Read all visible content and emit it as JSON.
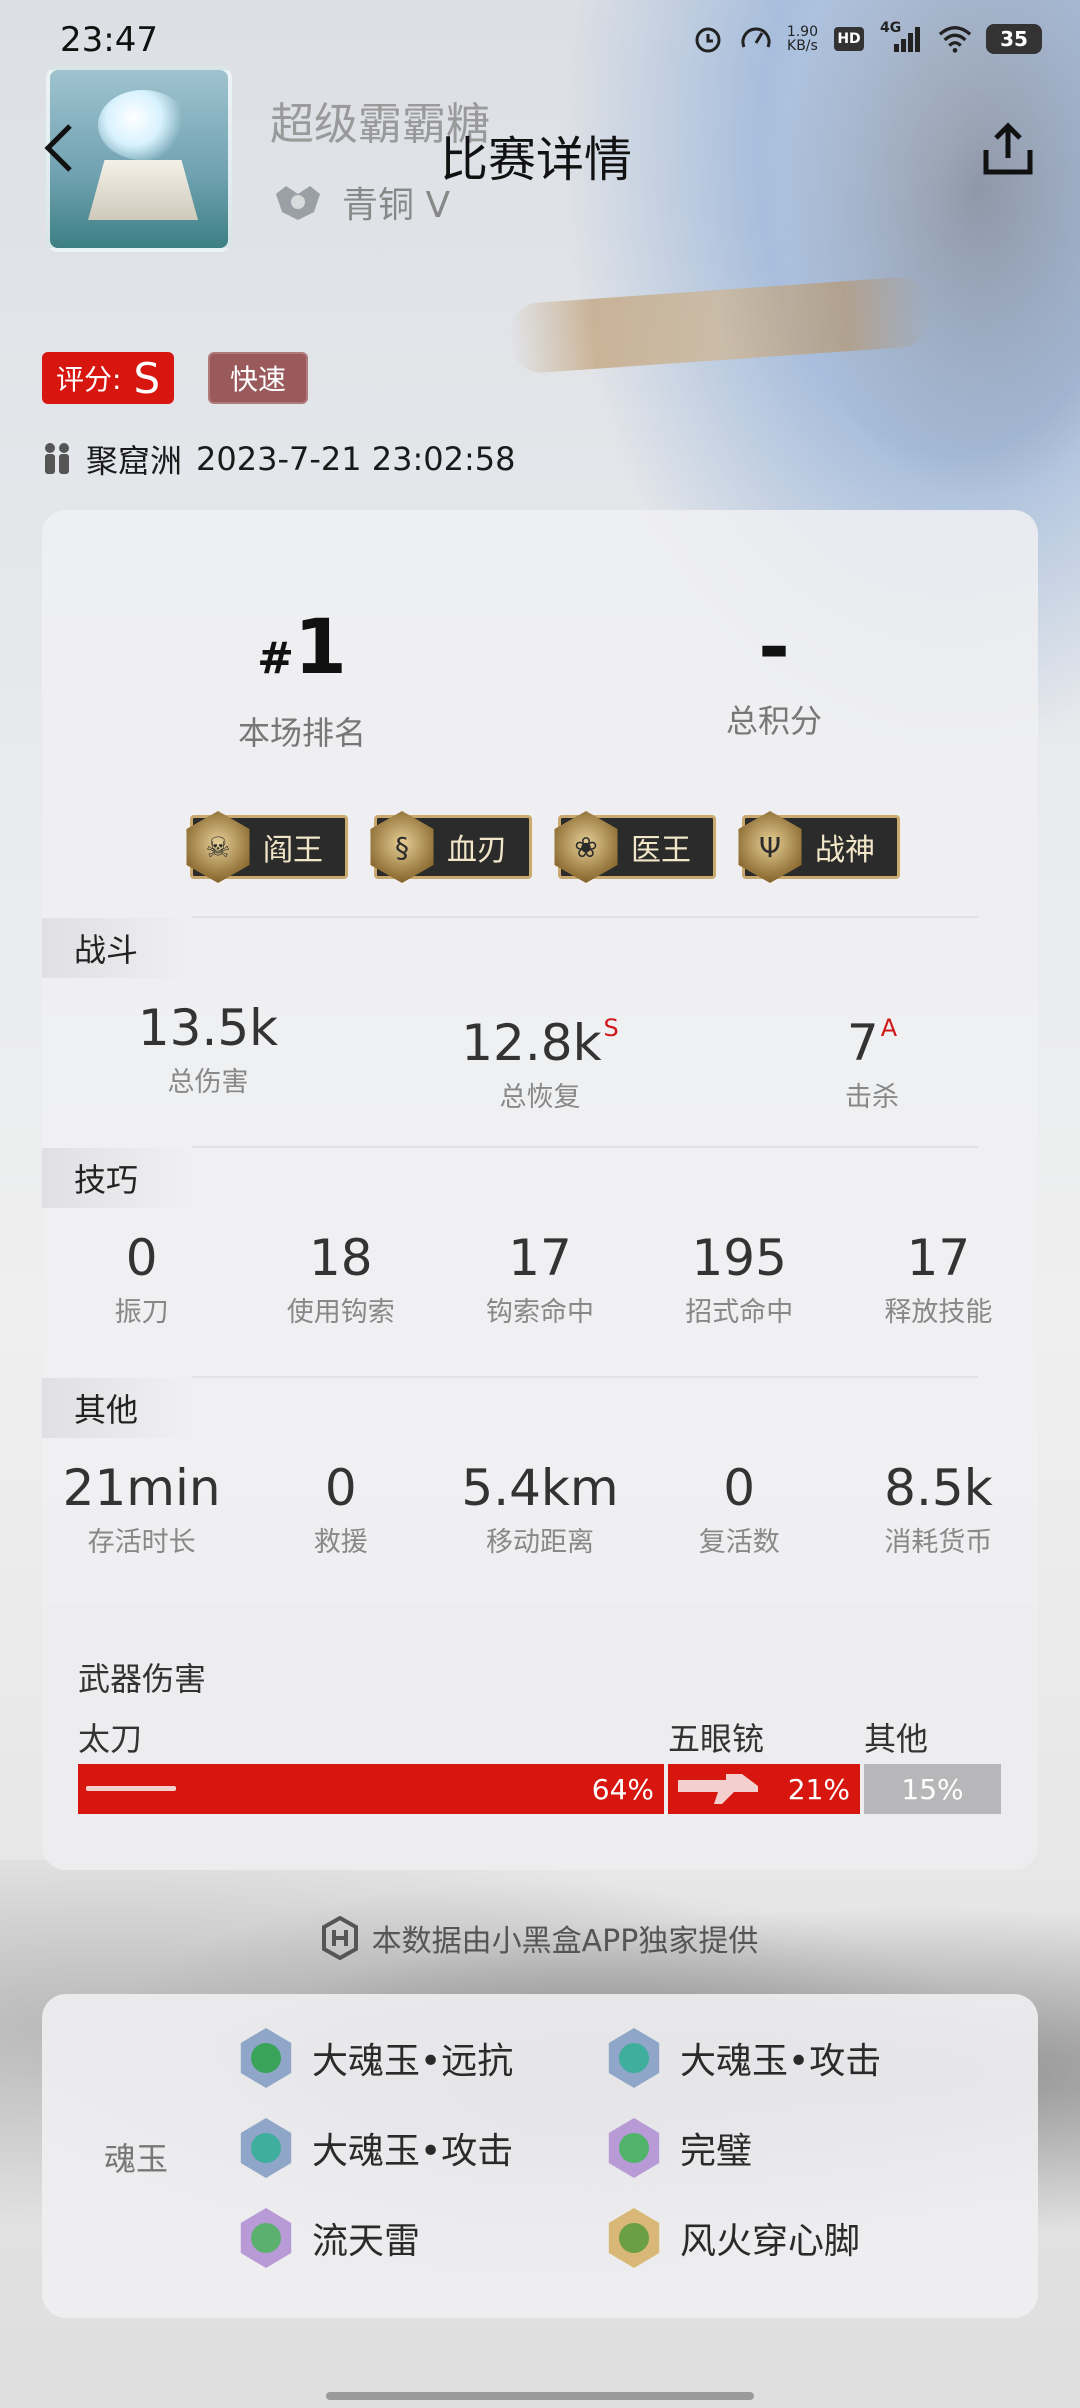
{
  "status_bar": {
    "time": "23:47",
    "speed_value": "1.90",
    "speed_unit": "KB/s",
    "hd": "HD",
    "network": "4G",
    "battery": "35"
  },
  "header": {
    "title": "比赛详情",
    "username": "超级霸霸糖",
    "rank": "青铜 V"
  },
  "match": {
    "score_label": "评分:",
    "score_grade": "S",
    "mode": "快速",
    "map": "聚窟洲",
    "datetime": "2023-7-21 23:02:58"
  },
  "summary": {
    "rank_hash": "#",
    "rank_value": "1",
    "rank_label": "本场排名",
    "points_value": "-",
    "points_label": "总积分"
  },
  "honors": [
    {
      "icon": "demon-mask-icon",
      "label": "阎王"
    },
    {
      "icon": "dragon-blade-icon",
      "label": "血刃"
    },
    {
      "icon": "lotus-icon",
      "label": "医王"
    },
    {
      "icon": "trident-icon",
      "label": "战神"
    }
  ],
  "combat": {
    "title": "战斗",
    "stats": [
      {
        "value": "13.5k",
        "tag": "",
        "label": "总伤害"
      },
      {
        "value": "12.8k",
        "tag": "S",
        "label": "总恢复"
      },
      {
        "value": "7",
        "tag": "A",
        "label": "击杀"
      }
    ]
  },
  "skill": {
    "title": "技巧",
    "stats": [
      {
        "value": "0",
        "label": "振刀"
      },
      {
        "value": "18",
        "label": "使用钩索"
      },
      {
        "value": "17",
        "label": "钩索命中"
      },
      {
        "value": "195",
        "label": "招式命中"
      },
      {
        "value": "17",
        "label": "释放技能"
      }
    ]
  },
  "other": {
    "title": "其他",
    "stats": [
      {
        "value": "21min",
        "label": "存活时长"
      },
      {
        "value": "0",
        "label": "救援"
      },
      {
        "value": "5.4km",
        "label": "移动距离"
      },
      {
        "value": "0",
        "label": "复活数"
      },
      {
        "value": "8.5k",
        "label": "消耗货币"
      }
    ]
  },
  "weapons": {
    "title": "武器伤害",
    "items": [
      {
        "name": "太刀",
        "percent": "64%",
        "share": 0.64,
        "color": "#d7160f"
      },
      {
        "name": "五眼铳",
        "percent": "21%",
        "share": 0.21,
        "color": "#d7160f"
      },
      {
        "name": "其他",
        "percent": "15%",
        "share": 0.15,
        "color": "#b7b7b9"
      }
    ]
  },
  "provider": "本数据由小黑盒APP独家提供",
  "soul_jade": {
    "label": "魂玉",
    "items": [
      {
        "name": "大魂玉•远抗",
        "color": "#3aa35a"
      },
      {
        "name": "大魂玉•攻击",
        "color": "#3fae9c"
      },
      {
        "name": "大魂玉•攻击",
        "color": "#3fae9c"
      },
      {
        "name": "完璧",
        "color": "#52b36c"
      },
      {
        "name": "流天雷",
        "color": "#5bb070"
      },
      {
        "name": "风火穿心脚",
        "color": "#6a9f45"
      }
    ]
  }
}
